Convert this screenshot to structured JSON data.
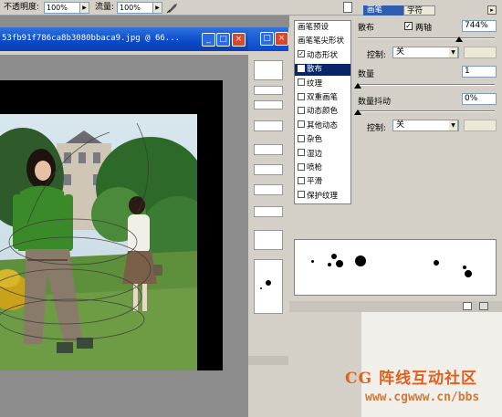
{
  "options_bar": {
    "opacity_label": "不透明度:",
    "opacity_value": "100%",
    "flow_label": "流量:",
    "flow_value": "100%"
  },
  "doc_window": {
    "title": "53fb91f786ca8b3080bbaca9.jpg @ 66...",
    "min_label": "_",
    "max_label": "□",
    "close_label": "×"
  },
  "brush_panel": {
    "tab_brush": "画笔",
    "tab_char": "字符",
    "list_items": [
      {
        "label": "画笔预设",
        "checkbox": false,
        "checked": false,
        "selected": false
      },
      {
        "label": "画笔笔尖形状",
        "checkbox": false,
        "checked": false,
        "selected": false
      },
      {
        "label": "动态形状",
        "checkbox": true,
        "checked": true,
        "selected": false
      },
      {
        "label": "散布",
        "checkbox": true,
        "checked": true,
        "selected": true
      },
      {
        "label": "纹理",
        "checkbox": true,
        "checked": false,
        "selected": false
      },
      {
        "label": "双重画笔",
        "checkbox": true,
        "checked": false,
        "selected": false
      },
      {
        "label": "动态颜色",
        "checkbox": true,
        "checked": false,
        "selected": false
      },
      {
        "label": "其他动态",
        "checkbox": true,
        "checked": false,
        "selected": false
      },
      {
        "label": "杂色",
        "checkbox": true,
        "checked": false,
        "selected": false
      },
      {
        "label": "湿边",
        "checkbox": true,
        "checked": false,
        "selected": false
      },
      {
        "label": "喷枪",
        "checkbox": true,
        "checked": false,
        "selected": false
      },
      {
        "label": "平滑",
        "checkbox": true,
        "checked": false,
        "selected": false
      },
      {
        "label": "保护纹理",
        "checkbox": true,
        "checked": false,
        "selected": false
      }
    ],
    "scatter_label": "散布",
    "both_axes_label": "两轴",
    "both_axes_checked": true,
    "scatter_value": "744%",
    "scatter_level": 0.74,
    "control_label": "控制:",
    "control_value": "关",
    "count_label": "数量",
    "count_value": "1",
    "count_level": 0.0,
    "count_jitter_label": "数量抖动",
    "count_jitter_value": "0%",
    "count_jitter_level": 0.0,
    "control2_label": "控制:",
    "control2_value": "关"
  },
  "watermark": {
    "line1_a": "CG",
    "line1_b": "阵线互动社区",
    "line2": "www.cgwww.cn/bbs"
  }
}
